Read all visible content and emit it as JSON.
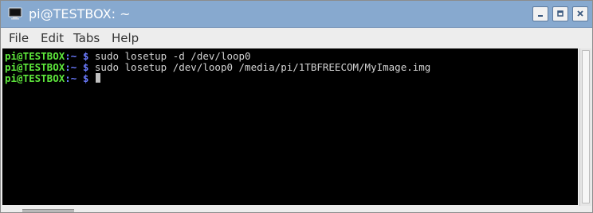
{
  "window": {
    "title": "pi@TESTBOX: ~",
    "icon": "terminal-icon",
    "buttons": [
      "minimize-icon",
      "maximize-icon",
      "close-icon"
    ]
  },
  "menu": {
    "file": "File",
    "edit": "Edit",
    "tabs": "Tabs",
    "help": "Help"
  },
  "terminal": {
    "lines": [
      {
        "host": "pi@TESTBOX",
        "path": ":~ $",
        "command": " sudo losetup -d /dev/loop0"
      },
      {
        "host": "pi@TESTBOX",
        "path": ":~ $",
        "command": " sudo losetup /dev/loop0 /media/pi/1TBFREECOM/MyImage.img"
      },
      {
        "host": "pi@TESTBOX",
        "path": ":~ $",
        "command": " "
      }
    ]
  },
  "colors": {
    "titlebar": "#87a9cf",
    "prompt_host": "#5ee83c",
    "prompt_path": "#6b7bff",
    "terminal_bg": "#000000"
  }
}
